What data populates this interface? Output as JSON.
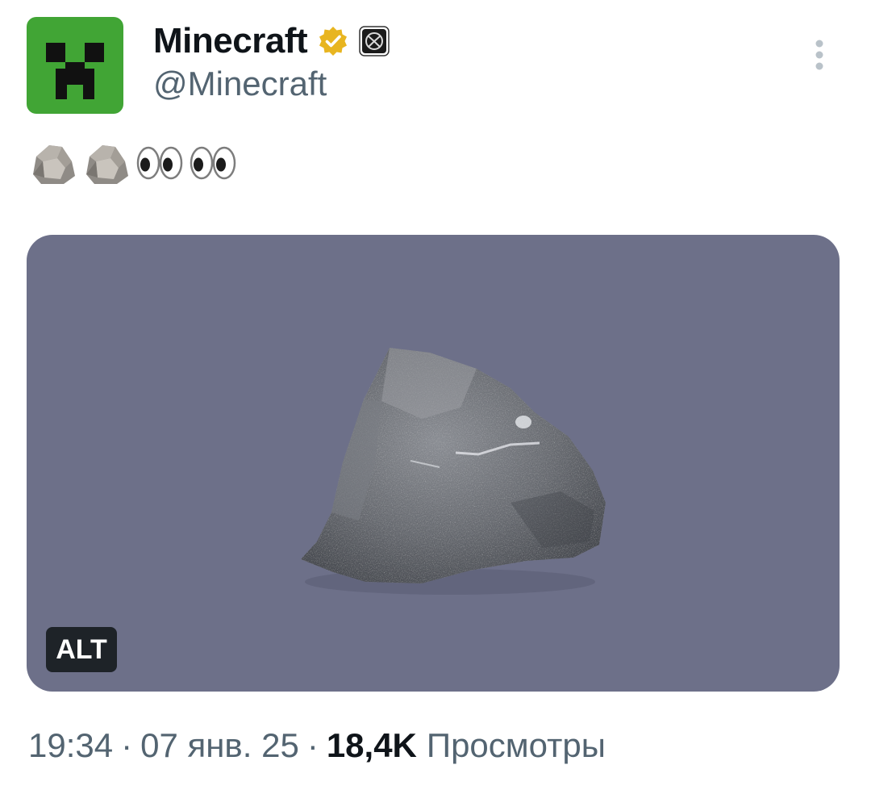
{
  "author": {
    "display_name": "Minecraft",
    "handle": "@Minecraft",
    "avatar_icon": "creeper-face-icon",
    "verified_badge_icon": "verified-gold-badge-icon",
    "affiliate_badge_icon": "xbox-affiliate-badge-icon"
  },
  "post": {
    "text_emojis": [
      "rock",
      "rock",
      "eyes",
      "eyes"
    ],
    "media_icon": "rock-photo",
    "alt_label": "ALT",
    "media_background": "#6d7089"
  },
  "meta": {
    "time": "19:34",
    "separator": "·",
    "date": "07 янв. 25",
    "views_count": "18,4K",
    "views_label": "Просмотры"
  },
  "actions": {
    "more_icon": "more-vertical-icon"
  }
}
